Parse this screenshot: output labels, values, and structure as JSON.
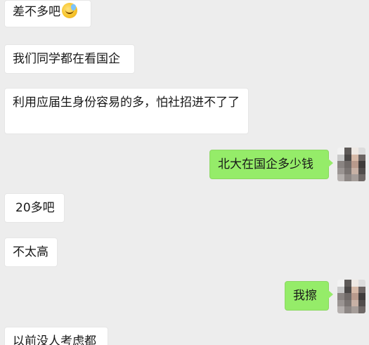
{
  "messages": [
    {
      "side": "in",
      "text": "差不多吧",
      "emoji": "crying-laughing-face"
    },
    {
      "side": "in",
      "text": "我们同学都在看国企"
    },
    {
      "side": "in",
      "text": "利用应届生身份容易的多，怕社招进不了了"
    },
    {
      "side": "out",
      "text": "北大在国企多少钱"
    },
    {
      "side": "in",
      "text": "20多吧"
    },
    {
      "side": "in",
      "text": "不太高"
    },
    {
      "side": "out",
      "text": "我擦"
    },
    {
      "side": "in",
      "text": "以前没人考虑都"
    }
  ]
}
